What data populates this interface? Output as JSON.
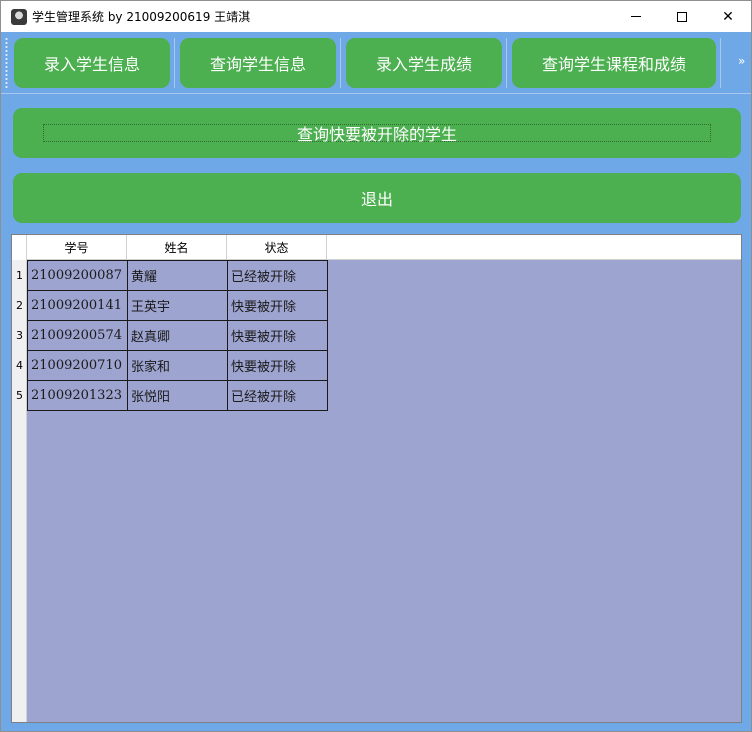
{
  "window": {
    "title": "学生管理系统 by 21009200619 王靖淇",
    "minimize_glyph": "",
    "close_glyph": "✕"
  },
  "toolbar": {
    "buttons": [
      {
        "label": "录入学生信息"
      },
      {
        "label": "查询学生信息"
      },
      {
        "label": "录入学生成绩"
      },
      {
        "label": "查询学生课程和成绩"
      }
    ],
    "more_glyph": "»"
  },
  "actions": {
    "query_label": "查询快要被开除的学生",
    "exit_label": "退出"
  },
  "table": {
    "columns": [
      "学号",
      "姓名",
      "状态"
    ],
    "rows": [
      {
        "index": "1",
        "cells": [
          "21009200087",
          "黄耀",
          "已经被开除"
        ]
      },
      {
        "index": "2",
        "cells": [
          "21009200141",
          "王英宇",
          "快要被开除"
        ]
      },
      {
        "index": "3",
        "cells": [
          "21009200574",
          "赵真卿",
          "快要被开除"
        ]
      },
      {
        "index": "4",
        "cells": [
          "21009200710",
          "张家和",
          "快要被开除"
        ]
      },
      {
        "index": "5",
        "cells": [
          "21009201323",
          "张悦阳",
          "已经被开除"
        ]
      }
    ]
  },
  "colors": {
    "window_bg": "#6fa8e6",
    "button_green": "#4caf50",
    "table_bg": "#9ea4d0"
  }
}
